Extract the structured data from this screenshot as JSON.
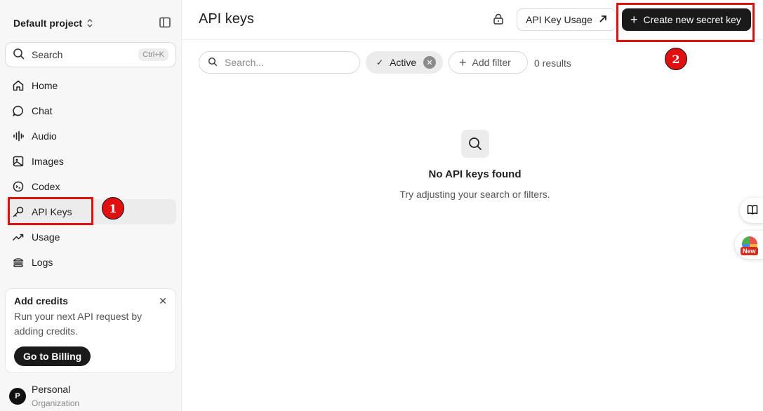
{
  "sidebar": {
    "project_name": "Default project",
    "search": {
      "label": "Search",
      "shortcut": "Ctrl+K"
    },
    "items": [
      {
        "label": "Home",
        "icon": "home-icon"
      },
      {
        "label": "Chat",
        "icon": "chat-icon"
      },
      {
        "label": "Audio",
        "icon": "audio-icon"
      },
      {
        "label": "Images",
        "icon": "image-icon"
      },
      {
        "label": "Codex",
        "icon": "codex-icon"
      },
      {
        "label": "API Keys",
        "icon": "key-icon",
        "active": true
      },
      {
        "label": "Usage",
        "icon": "trend-icon"
      },
      {
        "label": "Logs",
        "icon": "logs-icon"
      }
    ],
    "credits_card": {
      "title": "Add credits",
      "description": "Run your next API request by adding credits.",
      "button": "Go to Billing"
    },
    "org": {
      "avatar_letter": "P",
      "name": "Personal",
      "subtitle": "Organization"
    }
  },
  "header": {
    "title": "API keys",
    "usage_button": "API Key Usage",
    "create_button": "Create new secret key"
  },
  "filters": {
    "search_placeholder": "Search...",
    "active_chip": "Active",
    "add_filter": "Add filter",
    "results": "0 results"
  },
  "empty_state": {
    "title": "No API keys found",
    "description": "Try adjusting your search or filters."
  },
  "floating": {
    "new_badge": "New"
  },
  "annotations": {
    "one": "1",
    "two": "2"
  },
  "colors": {
    "accent_dark": "#1a1a1a",
    "annotation_red": "#e01010"
  }
}
